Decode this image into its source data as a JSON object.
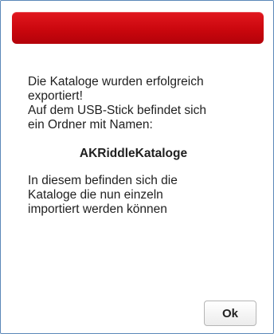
{
  "dialog": {
    "title": "",
    "message_lines_1": [
      "Die Kataloge wurden erfolgreich",
      "exportiert!",
      "Auf dem USB-Stick befindet sich",
      "ein Ordner mit Namen:"
    ],
    "folder_name": "AKRiddleKataloge",
    "message_lines_2": [
      "In diesem befinden sich die",
      "Kataloge die nun einzeln",
      "importiert werden können"
    ],
    "ok_label": "Ok"
  },
  "colors": {
    "titlebar": "#d10b12",
    "border": "#5b88b8",
    "text": "#1f1f1f"
  }
}
